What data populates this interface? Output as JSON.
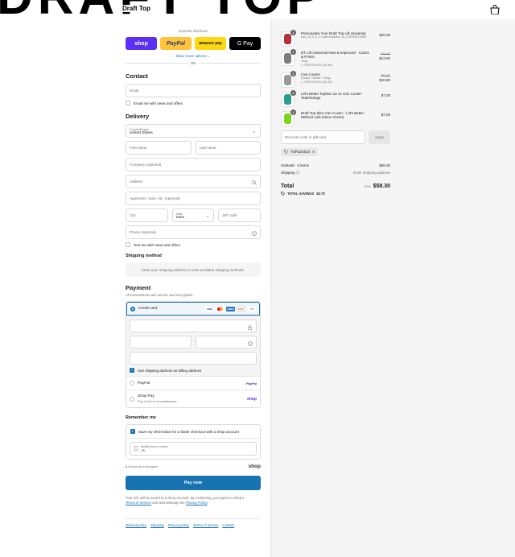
{
  "banner": {
    "text": "DRAFT TOP",
    "store_name": "Draft Top"
  },
  "express": {
    "heading": "Express checkout",
    "buttons": [
      {
        "label": "shop",
        "bg": "#5a31f4",
        "color": "#ffffff"
      },
      {
        "label": "PayPal",
        "bg": "#ffc439",
        "color": "#253b80"
      },
      {
        "label": "amazon pay",
        "bg": "#ffd814",
        "color": "#111111"
      },
      {
        "label": "G Pay",
        "bg": "#000000",
        "color": "#ffffff"
      }
    ],
    "show_more": "Show more options",
    "or": "OR"
  },
  "contact": {
    "title": "Contact",
    "email_placeholder": "Email",
    "news_label": "Email me with news and offers"
  },
  "delivery": {
    "title": "Delivery",
    "country_label": "Country/Region",
    "country_value": "United States",
    "first_name": "First name",
    "last_name": "Last name",
    "company": "Company (optional)",
    "address": "Address",
    "apartment": "Apartment, suite, etc. (optional)",
    "city": "City",
    "state_label": "State",
    "state_value": "Iowa",
    "zip": "ZIP code",
    "phone": "Phone (optional)",
    "text_me": "Text me with news and offers"
  },
  "shipping": {
    "title": "Shipping method",
    "info": "Enter your shipping address to view available shipping methods."
  },
  "payment": {
    "title": "Payment",
    "subtitle": "All transactions are secure and encrypted.",
    "credit_card": "Credit card",
    "card_brands": [
      "VISA",
      "MC",
      "AMEX",
      "DISC",
      "+4"
    ],
    "billing_label": "Use shipping address as billing address",
    "paypal": "PayPal",
    "paypal_brand": "PayPal",
    "shop_pay": "Shop Pay",
    "shop_pay_sub": "Pay in full or in installments",
    "shop_pay_brand": "shop"
  },
  "remember": {
    "title": "Remember me",
    "save_label": "Save my information for a faster checkout with a Shop account",
    "phone_label": "Mobile phone number",
    "phone_value": "+1"
  },
  "secure": {
    "text": "Secure and encrypted",
    "brand": "shop"
  },
  "pay_now": "Pay now",
  "legal": {
    "text": "Your info will be saved to a Shop account. By continuing, you agree to Shop's",
    "terms": "Terms of Service",
    "and": "and acknowledge the",
    "privacy": "Privacy Policy",
    "end": "."
  },
  "footer": [
    "Refund policy",
    "Shipping",
    "Privacy policy",
    "Terms of service",
    "Contact"
  ],
  "cart": {
    "items": [
      {
        "qty": "1",
        "name": "Personalize Your Draft Top Lift Universal",
        "meta": "size_id_0_0_0 customization_id_175394574959",
        "disc": "",
        "old": "",
        "price": "$20.00",
        "color": "#b5313c"
      },
      {
        "qty": "1",
        "name": "DT Lift Universal New & Improved - Colors & Prints!",
        "meta": "Gray",
        "disc": "TOPLESS10 (-$1.50)",
        "old": "$15.00",
        "price": "$13.50",
        "color": "#7a7d78"
      },
      {
        "qty": "1",
        "name": "Can Covers",
        "meta": "6 pack / White + Gray",
        "disc": "TOPLESS10 (-$1.20)",
        "old": "$12.00",
        "price": "$10.80",
        "color": "#9a9a9a"
      },
      {
        "qty": "1",
        "name": "Lilt's Better Topless 12 oz Can Cooler- Teal/Orange",
        "meta": "",
        "disc": "",
        "old": "",
        "price": "$7.00",
        "color": "#2a9d8f"
      },
      {
        "qty": "1",
        "name": "Draft Top Slim Can Cooler - Lilt's Better Without Lids (Neon Green)",
        "meta": "",
        "disc": "",
        "old": "",
        "price": "$7.00",
        "color": "#7ed321"
      }
    ],
    "discount_placeholder": "Discount code or gift card",
    "apply": "Apply",
    "tag": "TOPLESS10",
    "subtotal_label": "Subtotal · 5 items",
    "subtotal": "$58.30",
    "shipping_label": "Shipping",
    "shipping_value": "Enter shipping address",
    "total_label": "Total",
    "currency": "USD",
    "total": "$58.30",
    "savings_label": "TOTAL SAVINGS",
    "savings": "$2.70"
  }
}
